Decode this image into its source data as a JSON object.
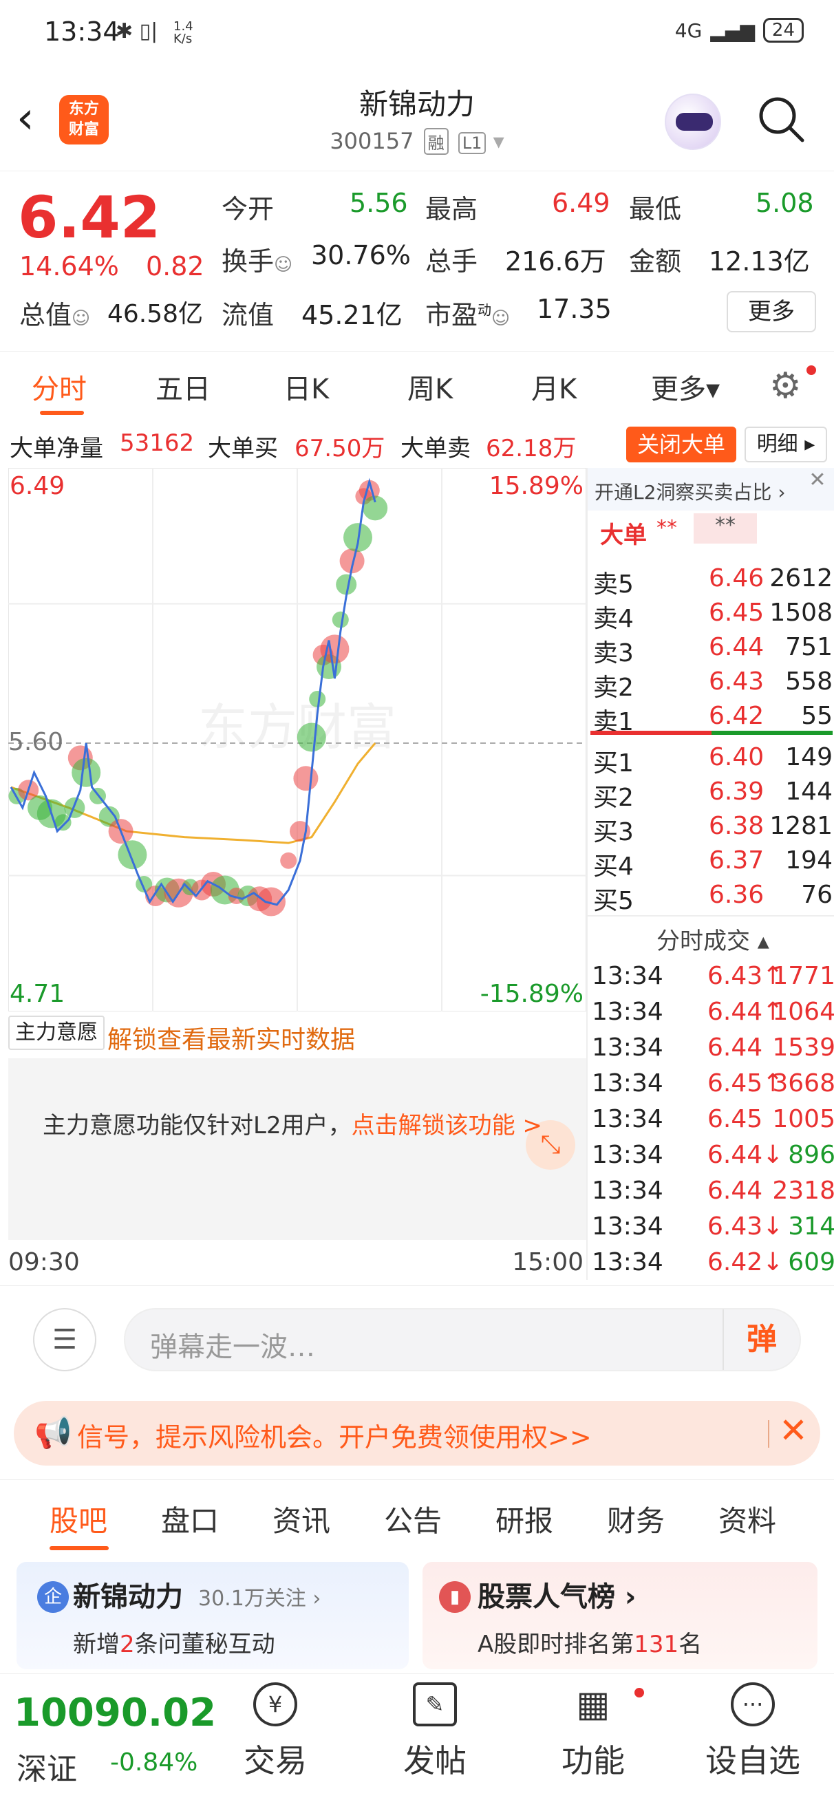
{
  "status": {
    "time": "13:34",
    "icons": "✱ ▯|",
    "speed": "1.4 K/s",
    "signal": "4G",
    "battery": "24"
  },
  "header": {
    "back_icon": "chevron-left",
    "logo_line1": "东方",
    "logo_line2": "财富",
    "title": "新锦动力",
    "code": "300157",
    "tag_rong": "融",
    "tag_level": "L1"
  },
  "quote": {
    "price": "6.42",
    "pct": "14.64%",
    "change": "0.82",
    "open_label": "今开",
    "open": "5.56",
    "high_label": "最高",
    "high": "6.49",
    "low_label": "最低",
    "low": "5.08",
    "turnover_label": "换手",
    "turnover": "30.76%",
    "volume_label": "总手",
    "volume": "216.6万",
    "amount_label": "金额",
    "amount": "12.13亿",
    "mktcap_label": "总值",
    "mktcap": "46.58亿",
    "float_label": "流值",
    "float": "45.21亿",
    "pe_label": "市盈",
    "pe_sup": "动",
    "pe": "17.35",
    "more": "更多"
  },
  "tabs": [
    "分时",
    "五日",
    "日K",
    "周K",
    "月K",
    "更多▾"
  ],
  "bigorder": {
    "net_label": "大单净量",
    "net": "53162",
    "buy_label": "大单买",
    "buy": "67.50万",
    "sell_label": "大单卖",
    "sell": "62.18万",
    "close_btn": "关闭大单",
    "detail_btn": "明细 ▸"
  },
  "chart_data": {
    "type": "line",
    "y_top_label": "6.49",
    "y_bottom_label": "4.71",
    "pct_top_label": "15.89%",
    "pct_bottom_label": "-15.89%",
    "ref_label": "5.60",
    "watermark": "东方财富",
    "x_start": "09:30",
    "x_end": "15:00",
    "ylim": [
      4.71,
      6.49
    ],
    "ref": 5.6,
    "price_points": [
      [
        0,
        5.45
      ],
      [
        2,
        5.38
      ],
      [
        4,
        5.5
      ],
      [
        6,
        5.42
      ],
      [
        8,
        5.3
      ],
      [
        10,
        5.34
      ],
      [
        12,
        5.44
      ],
      [
        13,
        5.6
      ],
      [
        14,
        5.45
      ],
      [
        16,
        5.4
      ],
      [
        18,
        5.35
      ],
      [
        20,
        5.25
      ],
      [
        22,
        5.15
      ],
      [
        24,
        5.06
      ],
      [
        26,
        5.12
      ],
      [
        28,
        5.06
      ],
      [
        30,
        5.12
      ],
      [
        32,
        5.08
      ],
      [
        34,
        5.13
      ],
      [
        36,
        5.11
      ],
      [
        38,
        5.08
      ],
      [
        40,
        5.07
      ],
      [
        42,
        5.09
      ],
      [
        44,
        5.06
      ],
      [
        46,
        5.05
      ],
      [
        48,
        5.1
      ],
      [
        50,
        5.2
      ],
      [
        51,
        5.3
      ],
      [
        52,
        5.5
      ],
      [
        53,
        5.7
      ],
      [
        54,
        5.86
      ],
      [
        55,
        5.95
      ],
      [
        56,
        5.82
      ],
      [
        57,
        5.98
      ],
      [
        58,
        6.1
      ],
      [
        59,
        6.2
      ],
      [
        60,
        6.28
      ],
      [
        61,
        6.42
      ],
      [
        62,
        6.49
      ],
      [
        63,
        6.42
      ]
    ],
    "avg_points": [
      [
        0,
        5.45
      ],
      [
        10,
        5.38
      ],
      [
        20,
        5.3
      ],
      [
        30,
        5.28
      ],
      [
        40,
        5.27
      ],
      [
        48,
        5.26
      ],
      [
        52,
        5.28
      ],
      [
        56,
        5.4
      ],
      [
        60,
        5.53
      ],
      [
        63,
        5.6
      ]
    ],
    "bubbles": [
      [
        1,
        5.42,
        "g"
      ],
      [
        3,
        5.44,
        "r"
      ],
      [
        5,
        5.38,
        "g"
      ],
      [
        7,
        5.36,
        "g"
      ],
      [
        9,
        5.33,
        "g"
      ],
      [
        11,
        5.38,
        "g"
      ],
      [
        12,
        5.55,
        "r"
      ],
      [
        13,
        5.5,
        "g"
      ],
      [
        15,
        5.42,
        "g"
      ],
      [
        17,
        5.35,
        "g"
      ],
      [
        19,
        5.3,
        "r"
      ],
      [
        21,
        5.22,
        "g"
      ],
      [
        23,
        5.12,
        "g"
      ],
      [
        25,
        5.08,
        "r"
      ],
      [
        27,
        5.1,
        "g"
      ],
      [
        29,
        5.09,
        "r"
      ],
      [
        31,
        5.11,
        "g"
      ],
      [
        33,
        5.1,
        "r"
      ],
      [
        35,
        5.12,
        "r"
      ],
      [
        37,
        5.1,
        "g"
      ],
      [
        39,
        5.08,
        "r"
      ],
      [
        41,
        5.08,
        "g"
      ],
      [
        43,
        5.07,
        "r"
      ],
      [
        45,
        5.06,
        "r"
      ],
      [
        48,
        5.2,
        "r"
      ],
      [
        50,
        5.3,
        "r"
      ],
      [
        51,
        5.48,
        "r"
      ],
      [
        52,
        5.62,
        "g"
      ],
      [
        53,
        5.75,
        "g"
      ],
      [
        54,
        5.9,
        "r"
      ],
      [
        55,
        5.86,
        "g"
      ],
      [
        56,
        5.92,
        "r"
      ],
      [
        57,
        6.02,
        "g"
      ],
      [
        58,
        6.14,
        "g"
      ],
      [
        59,
        6.22,
        "r"
      ],
      [
        60,
        6.3,
        "g"
      ],
      [
        61,
        6.44,
        "r"
      ],
      [
        62,
        6.46,
        "r"
      ],
      [
        63,
        6.4,
        "g"
      ]
    ]
  },
  "orderbook": {
    "l2_promo": "开通L2洞察买卖占比 ›",
    "big_label": "大单",
    "big_stars1": "**",
    "big_stars2": "**",
    "asks": [
      {
        "label": "卖5",
        "price": "6.46",
        "vol": "2612"
      },
      {
        "label": "卖4",
        "price": "6.45",
        "vol": "1508"
      },
      {
        "label": "卖3",
        "price": "6.44",
        "vol": "751"
      },
      {
        "label": "卖2",
        "price": "6.43",
        "vol": "558"
      },
      {
        "label": "卖1",
        "price": "6.42",
        "vol": "55"
      }
    ],
    "bids": [
      {
        "label": "买1",
        "price": "6.40",
        "vol": "149"
      },
      {
        "label": "买2",
        "price": "6.39",
        "vol": "144"
      },
      {
        "label": "买3",
        "price": "6.38",
        "vol": "1281"
      },
      {
        "label": "买4",
        "price": "6.37",
        "vol": "194"
      },
      {
        "label": "买5",
        "price": "6.36",
        "vol": "76"
      }
    ],
    "trades_title": "分时成交 ▴",
    "trades": [
      {
        "time": "13:34",
        "price": "6.43↑",
        "vol": "1771",
        "dir": "up"
      },
      {
        "time": "13:34",
        "price": "6.44↑",
        "vol": "1064",
        "dir": "up"
      },
      {
        "time": "13:34",
        "price": "6.44",
        "vol": "1539",
        "dir": "up"
      },
      {
        "time": "13:34",
        "price": "6.45↑",
        "vol": "3668",
        "dir": "up"
      },
      {
        "time": "13:34",
        "price": "6.45",
        "vol": "1005",
        "dir": "up"
      },
      {
        "time": "13:34",
        "price": "6.44↓",
        "vol": "896",
        "dir": "down"
      },
      {
        "time": "13:34",
        "price": "6.44",
        "vol": "2318",
        "dir": "up"
      },
      {
        "time": "13:34",
        "price": "6.43↓",
        "vol": "314",
        "dir": "down"
      },
      {
        "time": "13:34",
        "price": "6.42↓",
        "vol": "609",
        "dir": "down"
      }
    ]
  },
  "mainforce": {
    "select": "主力意愿 ▾",
    "unlock": "解锁查看最新实时数据",
    "notice": "主力意愿功能仅针对L2用户，",
    "notice_link": "点击解锁该功能 >"
  },
  "danmaku": {
    "placeholder": "弹幕走一波…",
    "send": "弹"
  },
  "banner": {
    "text": "信号，提示风险机会。开户免费领使用权>>"
  },
  "subtabs": [
    "股吧",
    "盘口",
    "资讯",
    "公告",
    "研报",
    "财务",
    "资料"
  ],
  "cards": {
    "c1_title": "新锦动力",
    "c1_follow": "30.1万关注 ›",
    "c1_sub_pre": "新增",
    "c1_sub_num": "2",
    "c1_sub_post": "条问董秘互动",
    "c2_title": "股票人气榜 ›",
    "c2_sub_pre": "A股即时排名第",
    "c2_sub_num": "131",
    "c2_sub_post": "名"
  },
  "bottomnav": {
    "index_value": "10090.02",
    "index_name": "深证",
    "index_pct": "-0.84%",
    "items": [
      "交易",
      "发帖",
      "功能",
      "设自选"
    ]
  }
}
